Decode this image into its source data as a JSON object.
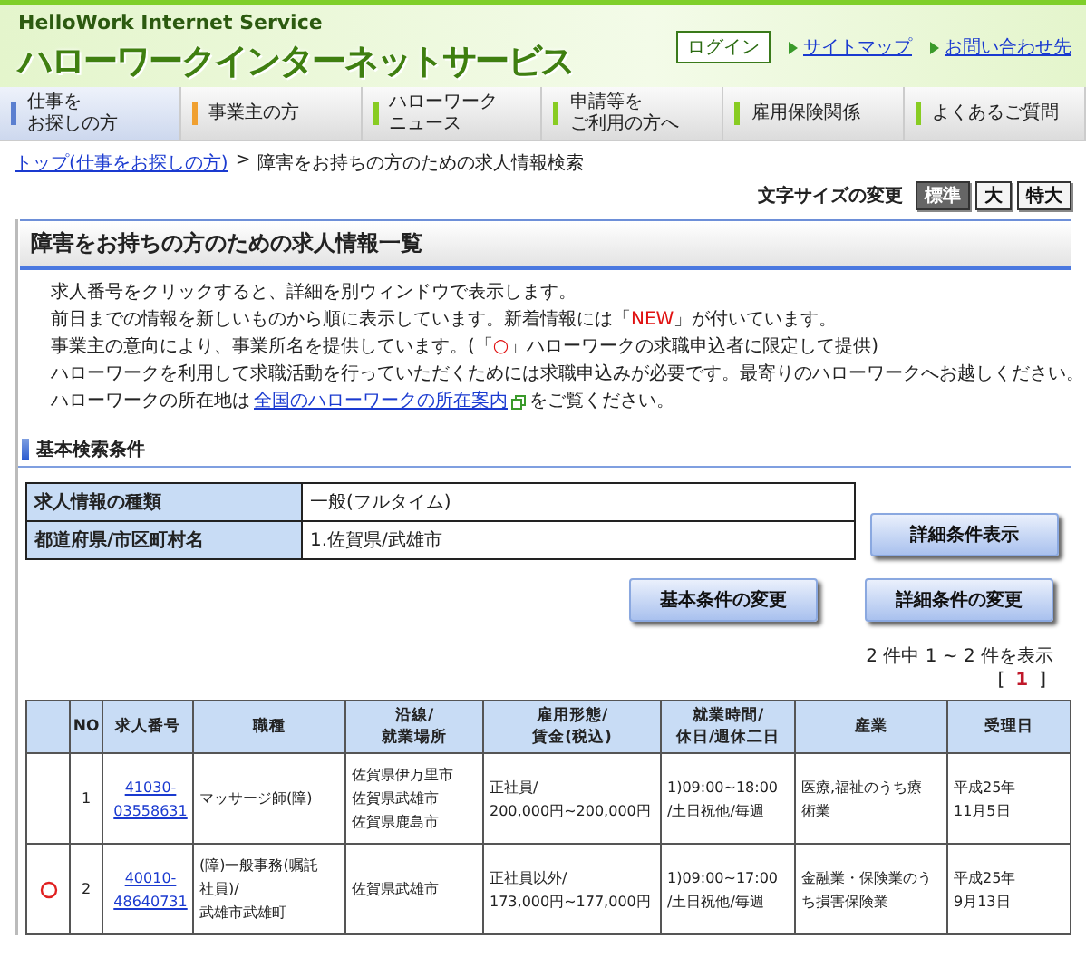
{
  "header": {
    "service_name": "HelloWork Internet Service",
    "title": "ハローワークインターネットサービス",
    "login": "ログイン",
    "links": [
      "サイトマップ",
      "お問い合わせ先"
    ]
  },
  "nav": [
    {
      "label": [
        "仕事を",
        "お探しの方"
      ],
      "selected": true,
      "color": "#5b7fd0"
    },
    {
      "label": [
        "事業主の方"
      ],
      "selected": false,
      "color": "#f0a030"
    },
    {
      "label": [
        "ハローワーク",
        "ニュース"
      ],
      "selected": false,
      "color": "#88cc22"
    },
    {
      "label": [
        "申請等を",
        "ご利用の方へ"
      ],
      "selected": false,
      "color": "#88cc22"
    },
    {
      "label": [
        "雇用保険関係"
      ],
      "selected": false,
      "color": "#88cc22"
    },
    {
      "label": [
        "よくあるご質問"
      ],
      "selected": false,
      "color": "#88cc22"
    }
  ],
  "breadcrumb": {
    "link": "トップ(仕事をお探しの方)",
    "separator": ">",
    "current": "障害をお持ちの方のための求人情報検索"
  },
  "font_size": {
    "label": "文字サイズの変更",
    "options": [
      {
        "label": "標準",
        "selected": true
      },
      {
        "label": "大",
        "selected": false
      },
      {
        "label": "特大",
        "selected": false
      }
    ]
  },
  "page_title": "障害をお持ちの方のための求人情報一覧",
  "notes": [
    [
      {
        "kind": "plain",
        "text": "求人番号をクリックすると、詳細を別ウィンドウで表示します。"
      }
    ],
    [
      {
        "kind": "plain",
        "text": "前日までの情報を新しいものから順に表示しています。新着情報には「"
      },
      {
        "kind": "red",
        "text": "NEW"
      },
      {
        "kind": "plain",
        "text": "」が付いています。"
      }
    ],
    [
      {
        "kind": "plain",
        "text": "事業主の意向により、事業所名を提供しています。(「"
      },
      {
        "kind": "red",
        "text": "○"
      },
      {
        "kind": "plain",
        "text": "」ハローワークの求職申込者に限定して提供)"
      }
    ],
    [
      {
        "kind": "plain",
        "text": "ハローワークを利用して求職活動を行っていただくためには求職申込みが必要です。最寄りのハローワークへお越しください。"
      }
    ],
    [
      {
        "kind": "plain",
        "text": "ハローワークの所在地は"
      },
      {
        "kind": "link",
        "text": "全国のハローワークの所在案内"
      },
      {
        "kind": "plain",
        "text": "をご覧ください。"
      }
    ]
  ],
  "conditions": {
    "heading": "基本検索条件",
    "rows": [
      {
        "label": "求人情報の種類",
        "value": "一般(フルタイム)"
      },
      {
        "label": "都道府県/市区町村名",
        "value": "1.佐賀県/武雄市"
      }
    ],
    "detail_button": "詳細条件表示",
    "buttons": [
      "基本条件の変更",
      "詳細条件の変更"
    ]
  },
  "results": {
    "count": "2 件中 1 ~ 2 件を表示",
    "open": "[",
    "close": "]",
    "pages": [
      {
        "label": "1",
        "selected": true
      }
    ],
    "columns": [
      [],
      [
        "NO"
      ],
      [
        "求人番号"
      ],
      [
        "職種"
      ],
      [
        "沿線/",
        "就業場所"
      ],
      [
        "雇用形態/",
        "賃金(税込)"
      ],
      [
        "就業時間/",
        "休日/週休二日"
      ],
      [
        "産業"
      ],
      [
        "受理日"
      ]
    ],
    "rows": [
      {
        "marked": false,
        "no": "1",
        "number": "41030-03558631",
        "job": [
          "マッサージ師(障)"
        ],
        "place": [
          "佐賀県伊万里市",
          "佐賀県武雄市",
          "佐賀県鹿島市"
        ],
        "employment": [
          "正社員/",
          "200,000円~200,000円"
        ],
        "hours": [
          "1)09:00~18:00",
          "/土日祝他/毎週"
        ],
        "industry": [
          "医療,福祉のうち療",
          "術業"
        ],
        "date": [
          "平成25年",
          "11月5日"
        ]
      },
      {
        "marked": true,
        "no": "2",
        "number": "40010-48640731",
        "job": [
          "(障)一般事務(嘱託",
          "社員)/",
          "武雄市武雄町"
        ],
        "place": [
          "佐賀県武雄市"
        ],
        "employment": [
          "正社員以外/",
          "173,000円~177,000円"
        ],
        "hours": [
          "1)09:00~17:00",
          "/土日祝他/毎週"
        ],
        "industry": [
          "金融業・保険業のう",
          "ち損害保険業"
        ],
        "date": [
          "平成25年",
          "9月13日"
        ]
      }
    ]
  }
}
